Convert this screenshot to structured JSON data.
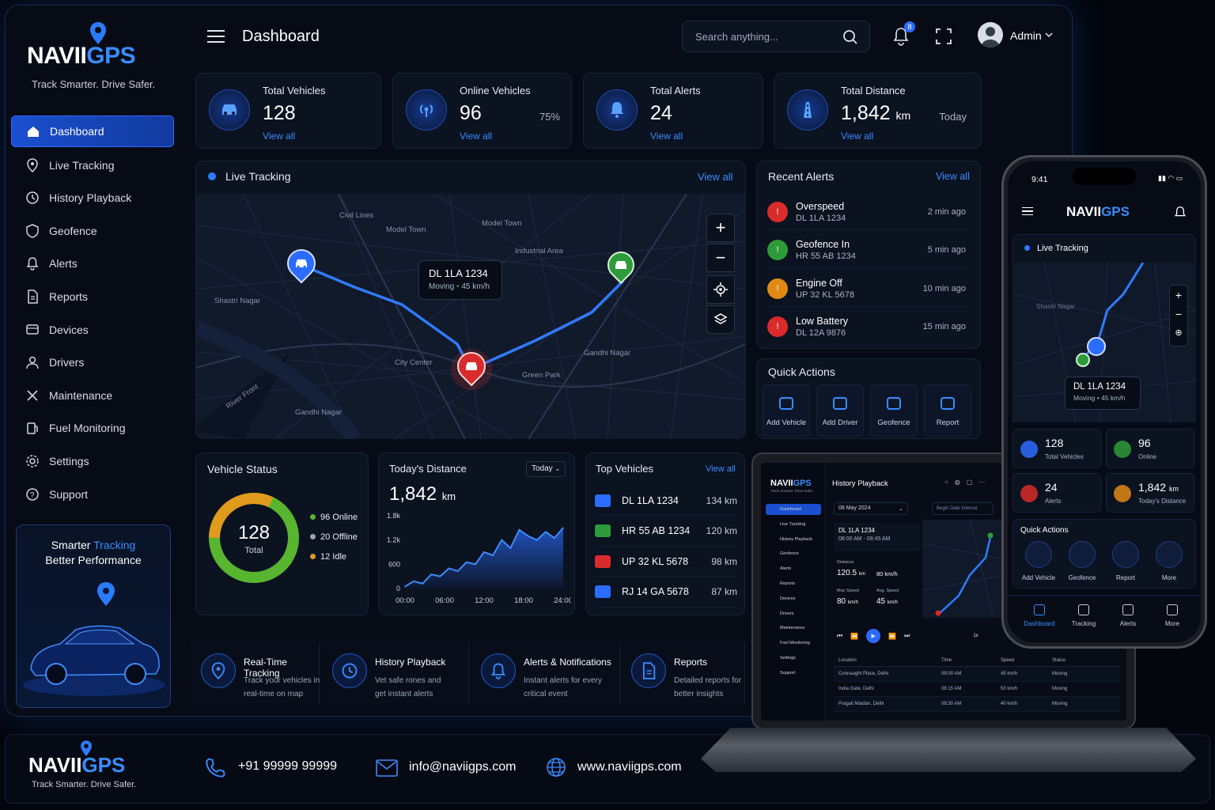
{
  "brand": {
    "name_a": "NAVII",
    "name_b": "GPS",
    "tagline": "Track Smarter. Drive Safer."
  },
  "sidebar": {
    "items": [
      {
        "label": "Dashboard",
        "icon": "home-icon",
        "active": true
      },
      {
        "label": "Live Tracking",
        "icon": "location-pin-icon"
      },
      {
        "label": "History Playback",
        "icon": "history-icon"
      },
      {
        "label": "Geofence",
        "icon": "shield-icon"
      },
      {
        "label": "Alerts",
        "icon": "bell-icon"
      },
      {
        "label": "Reports",
        "icon": "document-icon"
      },
      {
        "label": "Devices",
        "icon": "device-icon"
      },
      {
        "label": "Drivers",
        "icon": "user-icon"
      },
      {
        "label": "Maintenance",
        "icon": "tools-icon"
      },
      {
        "label": "Fuel Monitoring",
        "icon": "fuel-icon"
      },
      {
        "label": "Settings",
        "icon": "gear-icon"
      },
      {
        "label": "Support",
        "icon": "help-icon"
      }
    ],
    "promo": {
      "line1_a": "Smarter ",
      "line1_b": "Tracking",
      "line2": "Better Performance"
    }
  },
  "header": {
    "title": "Dashboard",
    "search_placeholder": "Search anything...",
    "notif_count": "8",
    "user": "Admin"
  },
  "stats": [
    {
      "title": "Total Vehicles",
      "value": "128",
      "link": "View all",
      "icon": "car-icon"
    },
    {
      "title": "Online Vehicles",
      "value": "96",
      "extra": "75%",
      "link": "View all",
      "icon": "signal-icon"
    },
    {
      "title": "Total Alerts",
      "value": "24",
      "link": "View all",
      "icon": "bell-icon"
    },
    {
      "title": "Total Distance",
      "value": "1,842",
      "unit": "km",
      "extra": "Today",
      "link": "View all",
      "icon": "road-icon"
    }
  ],
  "map": {
    "title": "Live Tracking",
    "link": "View all",
    "labels": [
      "Civil Lines",
      "Model Town",
      "Model Town",
      "Industrial Area",
      "Shastri Nagar",
      "City Center",
      "Green Park",
      "Gandhi Nagar",
      "River Front",
      "Gandhi Nagar"
    ],
    "tooltip_id": "DL 1LA 1234",
    "tooltip_state": "Moving",
    "tooltip_speed": "45 km/h"
  },
  "recent_alerts": {
    "title": "Recent Alerts",
    "link": "View all",
    "items": [
      {
        "title": "Overspeed",
        "plate": "DL 1LA 1234",
        "time": "2 min ago",
        "color": "#d92b2b"
      },
      {
        "title": "Geofence In",
        "plate": "HR 55 AB 1234",
        "time": "5 min ago",
        "color": "#2e9b3a"
      },
      {
        "title": "Engine Off",
        "plate": "UP 32 KL 5678",
        "time": "10 min ago",
        "color": "#e08a14"
      },
      {
        "title": "Low Battery",
        "plate": "DL 12A 9876",
        "time": "15 min ago",
        "color": "#d92b2b"
      }
    ]
  },
  "quick_actions": {
    "title": "Quick Actions",
    "items": [
      "Add Vehicle",
      "Add Driver",
      "Geofence",
      "Report"
    ]
  },
  "vehicle_status": {
    "title": "Vehicle Status",
    "total": "128",
    "total_label": "Total",
    "online": "96 Online",
    "offline": "20 Offline",
    "idle": "12 Idle"
  },
  "distance": {
    "title": "Today's Distance",
    "value": "1,842",
    "unit": "km",
    "filter": "Today"
  },
  "chart_data": {
    "type": "area",
    "x": [
      "00:00",
      "06:00",
      "12:00",
      "18:00",
      "24:00"
    ],
    "y_ticks": [
      "0",
      "600",
      "1.2k",
      "1.8k"
    ],
    "ylim": [
      0,
      1800
    ],
    "series": [
      {
        "values": [
          50,
          180,
          120,
          350,
          300,
          500,
          430,
          650,
          600,
          900,
          820,
          1200,
          1000,
          1450,
          1300,
          1200,
          1400,
          1250,
          1500
        ]
      }
    ]
  },
  "top_vehicles": {
    "title": "Top Vehicles",
    "link": "View all",
    "items": [
      {
        "plate": "DL 1LA 1234",
        "km": "134 km",
        "color": "#2b6cff"
      },
      {
        "plate": "HR 55 AB 1234",
        "km": "120 km",
        "color": "#2e9b3a"
      },
      {
        "plate": "UP 32 KL 5678",
        "km": "98 km",
        "color": "#d92b2b"
      },
      {
        "plate": "RJ 14 GA 5678",
        "km": "87 km",
        "color": "#2b6cff"
      }
    ]
  },
  "features": [
    {
      "title": "Real-Time Tracking",
      "desc": "Track your vehicles in real-time on map"
    },
    {
      "title": "History Playback",
      "desc": "Vet safe rones and get instant alerts"
    },
    {
      "title": "Alerts & Notifications",
      "desc": "Instant alerts for every critical event"
    },
    {
      "title": "Reports",
      "desc": "Detailed reports for better insights"
    }
  ],
  "footer": {
    "phone": "+91 99999 99999",
    "email": "info@naviigps.com",
    "web": "www.naviigps.com"
  },
  "laptop": {
    "title": "History Playback",
    "date": "08 May 2024",
    "filter": "Begin Date Interval",
    "vehicle": "DL 1LA 1234",
    "time_range": "08:00 AM - 08:45 AM",
    "distance_label": "Distance",
    "distance": "120.5",
    "distance_unit": "km",
    "speed_top": "80 km/h",
    "max_label": "Max Speed",
    "max_speed": "80",
    "avg_label": "Avg. Speed",
    "avg_speed": "45",
    "speed_unit": "km/h",
    "speed_mult": "1x",
    "nav": [
      "Dashboard",
      "Live Tracking",
      "History Playback",
      "Geofence",
      "Alerts",
      "Reports",
      "Devices",
      "Drivers",
      "Maintenance",
      "Fuel Monitoring",
      "Settings",
      "Support"
    ],
    "cols": [
      "Location",
      "Time",
      "Speed",
      "Status"
    ],
    "rows": [
      [
        "Connaught Place, Delhi",
        "08:00 AM",
        "45 km/h",
        "Moving"
      ],
      [
        "India Gate, Delhi",
        "08:15 AM",
        "50 km/h",
        "Moving"
      ],
      [
        "Pragati Maidan, Delhi",
        "08:30 AM",
        "40 km/h",
        "Moving"
      ]
    ]
  },
  "phone": {
    "time": "9:41",
    "map_title": "Live Tracking",
    "map_label": "Shastri Nagar",
    "tooltip_id": "DL 1LA 1234",
    "tooltip_sub": "Moving • 45 km/h",
    "stats": [
      {
        "v": "128",
        "l": "Total Vehicles"
      },
      {
        "v": "96",
        "l": "Online"
      },
      {
        "v": "24",
        "l": "Alerts"
      },
      {
        "v": "1,842",
        "u": "km",
        "l": "Today's Distance"
      }
    ],
    "qa_title": "Quick Actions",
    "qa": [
      "Add Vehicle",
      "Geofence",
      "Report",
      "More"
    ],
    "tabs": [
      "Dashboard",
      "Tracking",
      "Alerts",
      "More"
    ]
  }
}
